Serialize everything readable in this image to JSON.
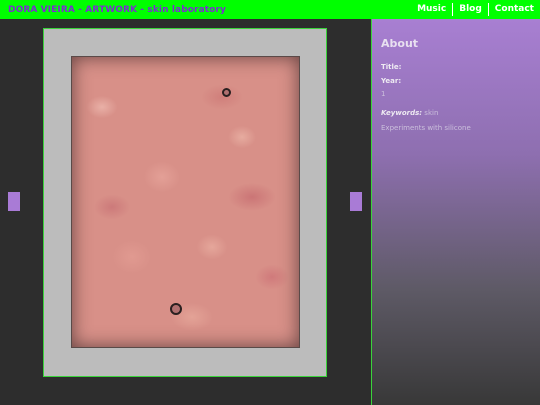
{
  "header": {
    "site_title": "DORA VIEIRA - ARTWORK - skin laboratory",
    "nav": [
      {
        "label": "Music"
      },
      {
        "label": "Blog"
      },
      {
        "label": "Contact"
      }
    ],
    "bar_color": "#00ff00",
    "title_color": "#7b2fd0"
  },
  "viewer": {
    "prev_icon": "previous-arrow",
    "next_icon": "next-arrow"
  },
  "sidebar": {
    "heading": "About",
    "title_label": "Title:",
    "title_value": "",
    "year_label": "Year:",
    "year_value": "1",
    "keywords_label": "Keywords:",
    "keywords_value": "skin",
    "description": "Experiments with silicone"
  }
}
